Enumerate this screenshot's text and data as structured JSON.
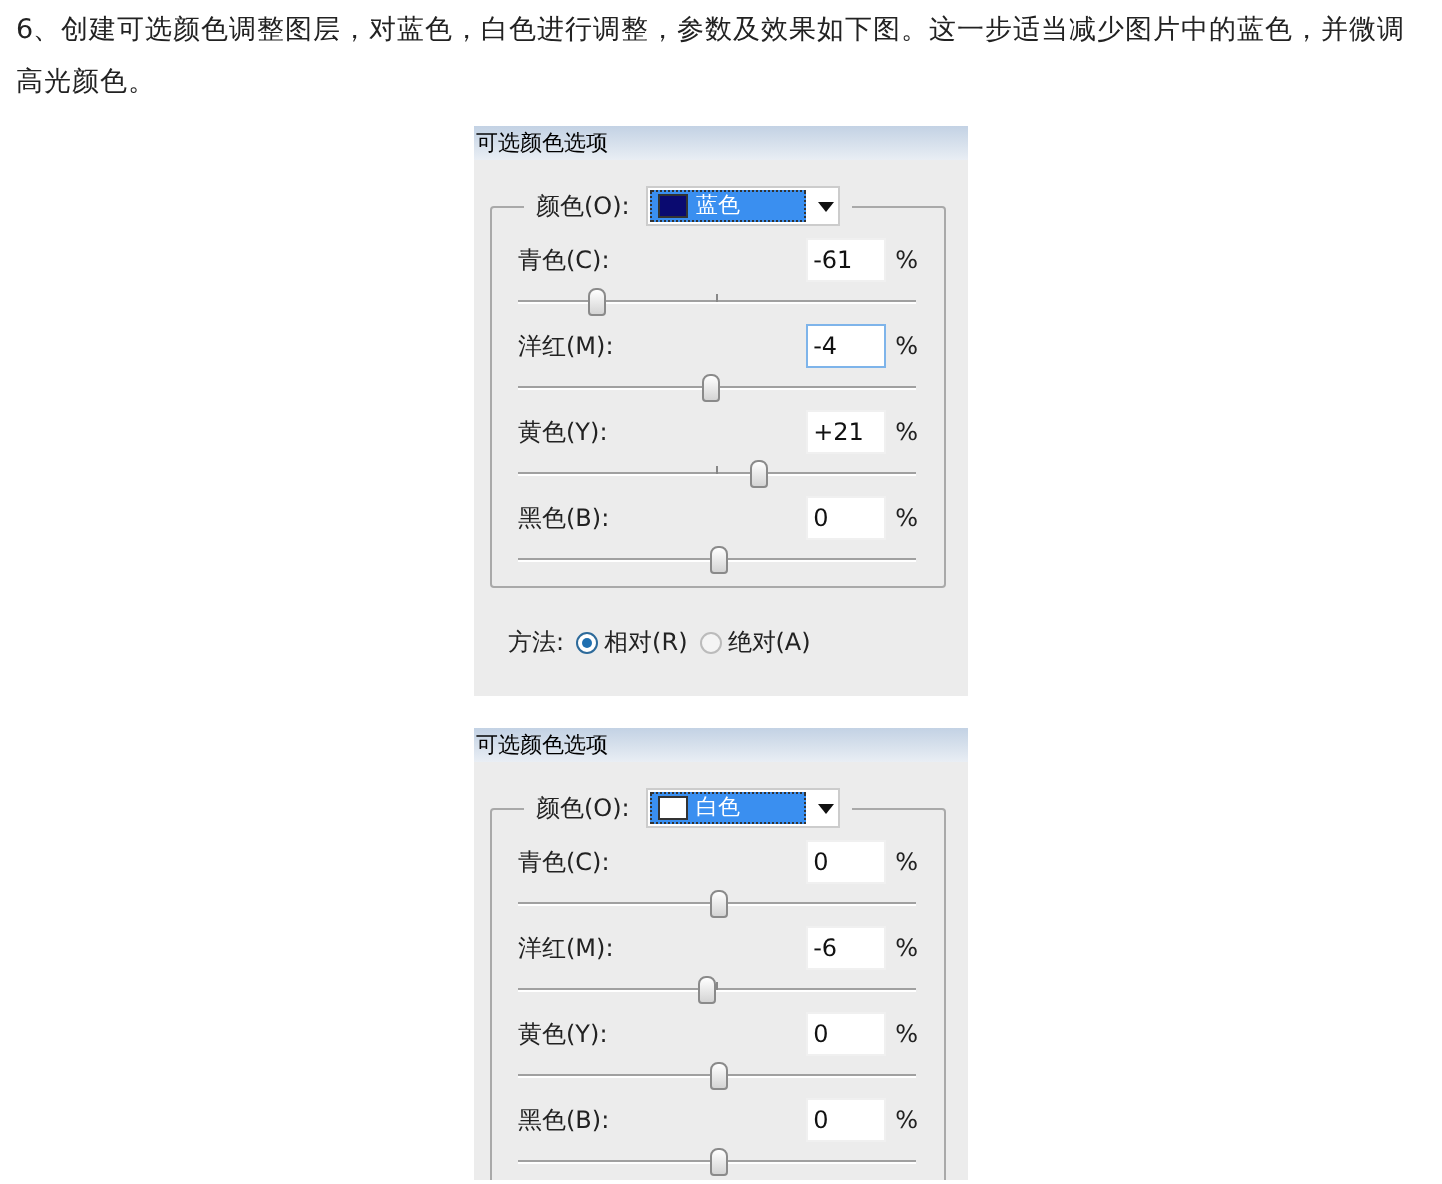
{
  "intro": "6、创建可选颜色调整图层，对蓝色，白色进行调整，参数及效果如下图。这一步适当减少图片中的蓝色，并微调高光颜色。",
  "panels": [
    {
      "title": "可选颜色选项",
      "color_label": "颜色(O):",
      "color_value": "蓝色",
      "color": "#0a0a70",
      "channels": [
        {
          "label": "青色(C):",
          "value": "-61",
          "unit": "%",
          "level": 0.195,
          "focused": false
        },
        {
          "label": "洋红(M):",
          "value": "-4",
          "unit": "%",
          "level": 0.48,
          "focused": true
        },
        {
          "label": "黄色(Y):",
          "value": "+21",
          "unit": "%",
          "level": 0.605,
          "focused": false
        },
        {
          "label": "黑色(B):",
          "value": "0",
          "unit": "%",
          "level": 0.5,
          "focused": false
        }
      ],
      "method": {
        "label": "方法:",
        "options": [
          {
            "label": "相对(R)",
            "selected": true
          },
          {
            "label": "绝对(A)",
            "selected": false
          }
        ]
      }
    },
    {
      "title": "可选颜色选项",
      "color_label": "颜色(O):",
      "color_value": "白色",
      "color": "#ffffff",
      "channels": [
        {
          "label": "青色(C):",
          "value": "0",
          "unit": "%",
          "level": 0.5,
          "focused": false
        },
        {
          "label": "洋红(M):",
          "value": "-6",
          "unit": "%",
          "level": 0.47,
          "focused": false
        },
        {
          "label": "黄色(Y):",
          "value": "0",
          "unit": "%",
          "level": 0.5,
          "focused": false
        },
        {
          "label": "黑色(B):",
          "value": "0",
          "unit": "%",
          "level": 0.5,
          "focused": false
        }
      ]
    }
  ]
}
